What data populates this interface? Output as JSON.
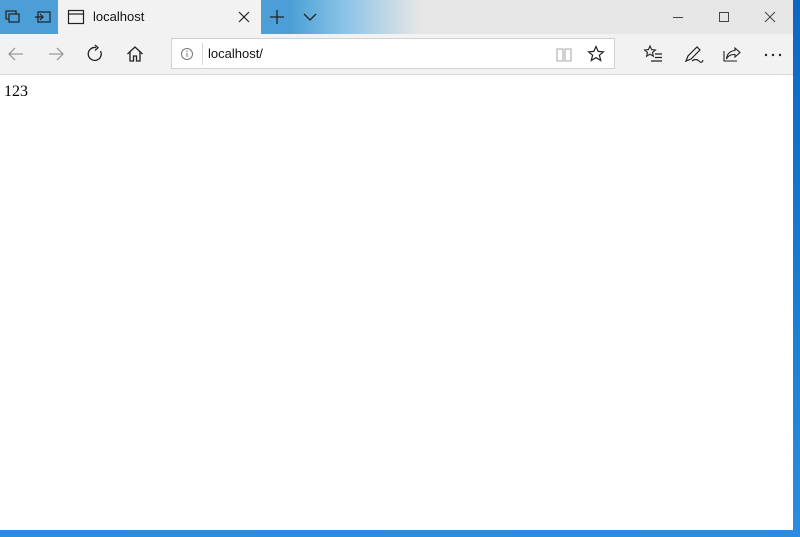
{
  "tab": {
    "title": "localhost"
  },
  "address": {
    "url": "localhost/"
  },
  "page": {
    "text": "123"
  },
  "icons": {
    "tab_actions": "tab-actions-icon",
    "set_aside": "set-aside-tabs-icon",
    "page": "page-icon",
    "close_tab": "close-icon",
    "new_tab": "plus-icon",
    "tab_preview": "chevron-down-icon",
    "minimize": "minimize-icon",
    "maximize": "maximize-icon",
    "close_window": "close-icon",
    "back": "back-arrow-icon",
    "forward": "forward-arrow-icon",
    "refresh": "refresh-icon",
    "home": "home-icon",
    "info": "info-icon",
    "reading_view": "book-icon",
    "favorite": "star-icon",
    "favorites_hub": "favorites-list-icon",
    "notes": "pen-icon",
    "share": "share-icon",
    "more": "more-icon"
  },
  "colors": {
    "titlebar_accent": "#4b9fd6",
    "desktop": "#1a7fd6"
  }
}
